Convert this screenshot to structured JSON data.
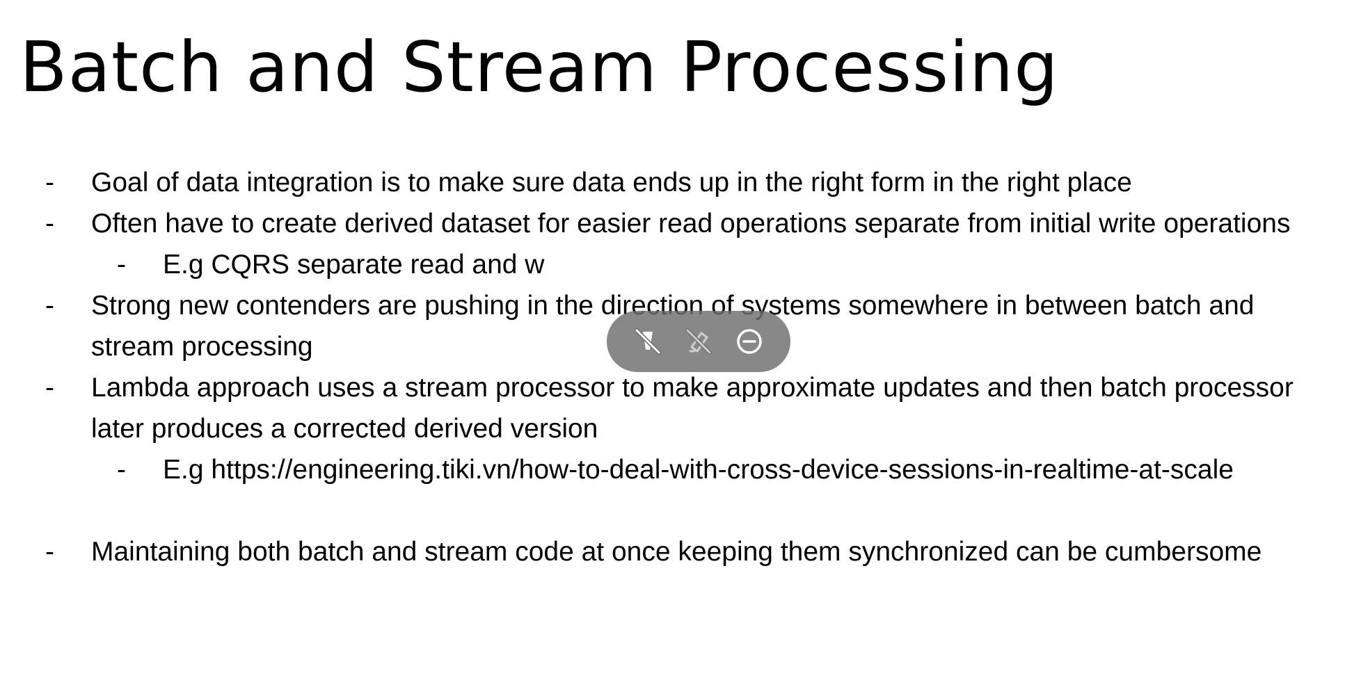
{
  "slide": {
    "title": "Batch and Stream Processing",
    "bullet_marker": "-",
    "bullets": [
      {
        "level": 1,
        "text": "Goal of data integration is to make sure data ends up in the right form in the right place"
      },
      {
        "level": 1,
        "text": "Often have to create derived dataset for easier read operations separate from initial write operations"
      },
      {
        "level": 2,
        "text": "E.g CQRS separate read and w"
      },
      {
        "level": 1,
        "text": "Strong new contenders are pushing in the direction of systems somewhere in between batch and stream processing"
      },
      {
        "level": 1,
        "text": "Lambda approach uses a stream processor to make approximate updates and then batch processor later produces a corrected derived version"
      },
      {
        "level": 2,
        "text": "E.g https://engineering.tiki.vn/how-to-deal-with-cross-device-sessions-in-realtime-at-scale"
      },
      {
        "level": 1,
        "text": "Maintaining both batch and stream code at once keeping them synchronized can be cumbersome"
      }
    ]
  },
  "toolbar": {
    "background": "#6e6e6e",
    "icon_color": "#ffffff",
    "buttons": [
      {
        "icon": "pen-off-icon"
      },
      {
        "icon": "highlighter-off-icon"
      },
      {
        "icon": "minus-circle-icon"
      }
    ]
  }
}
